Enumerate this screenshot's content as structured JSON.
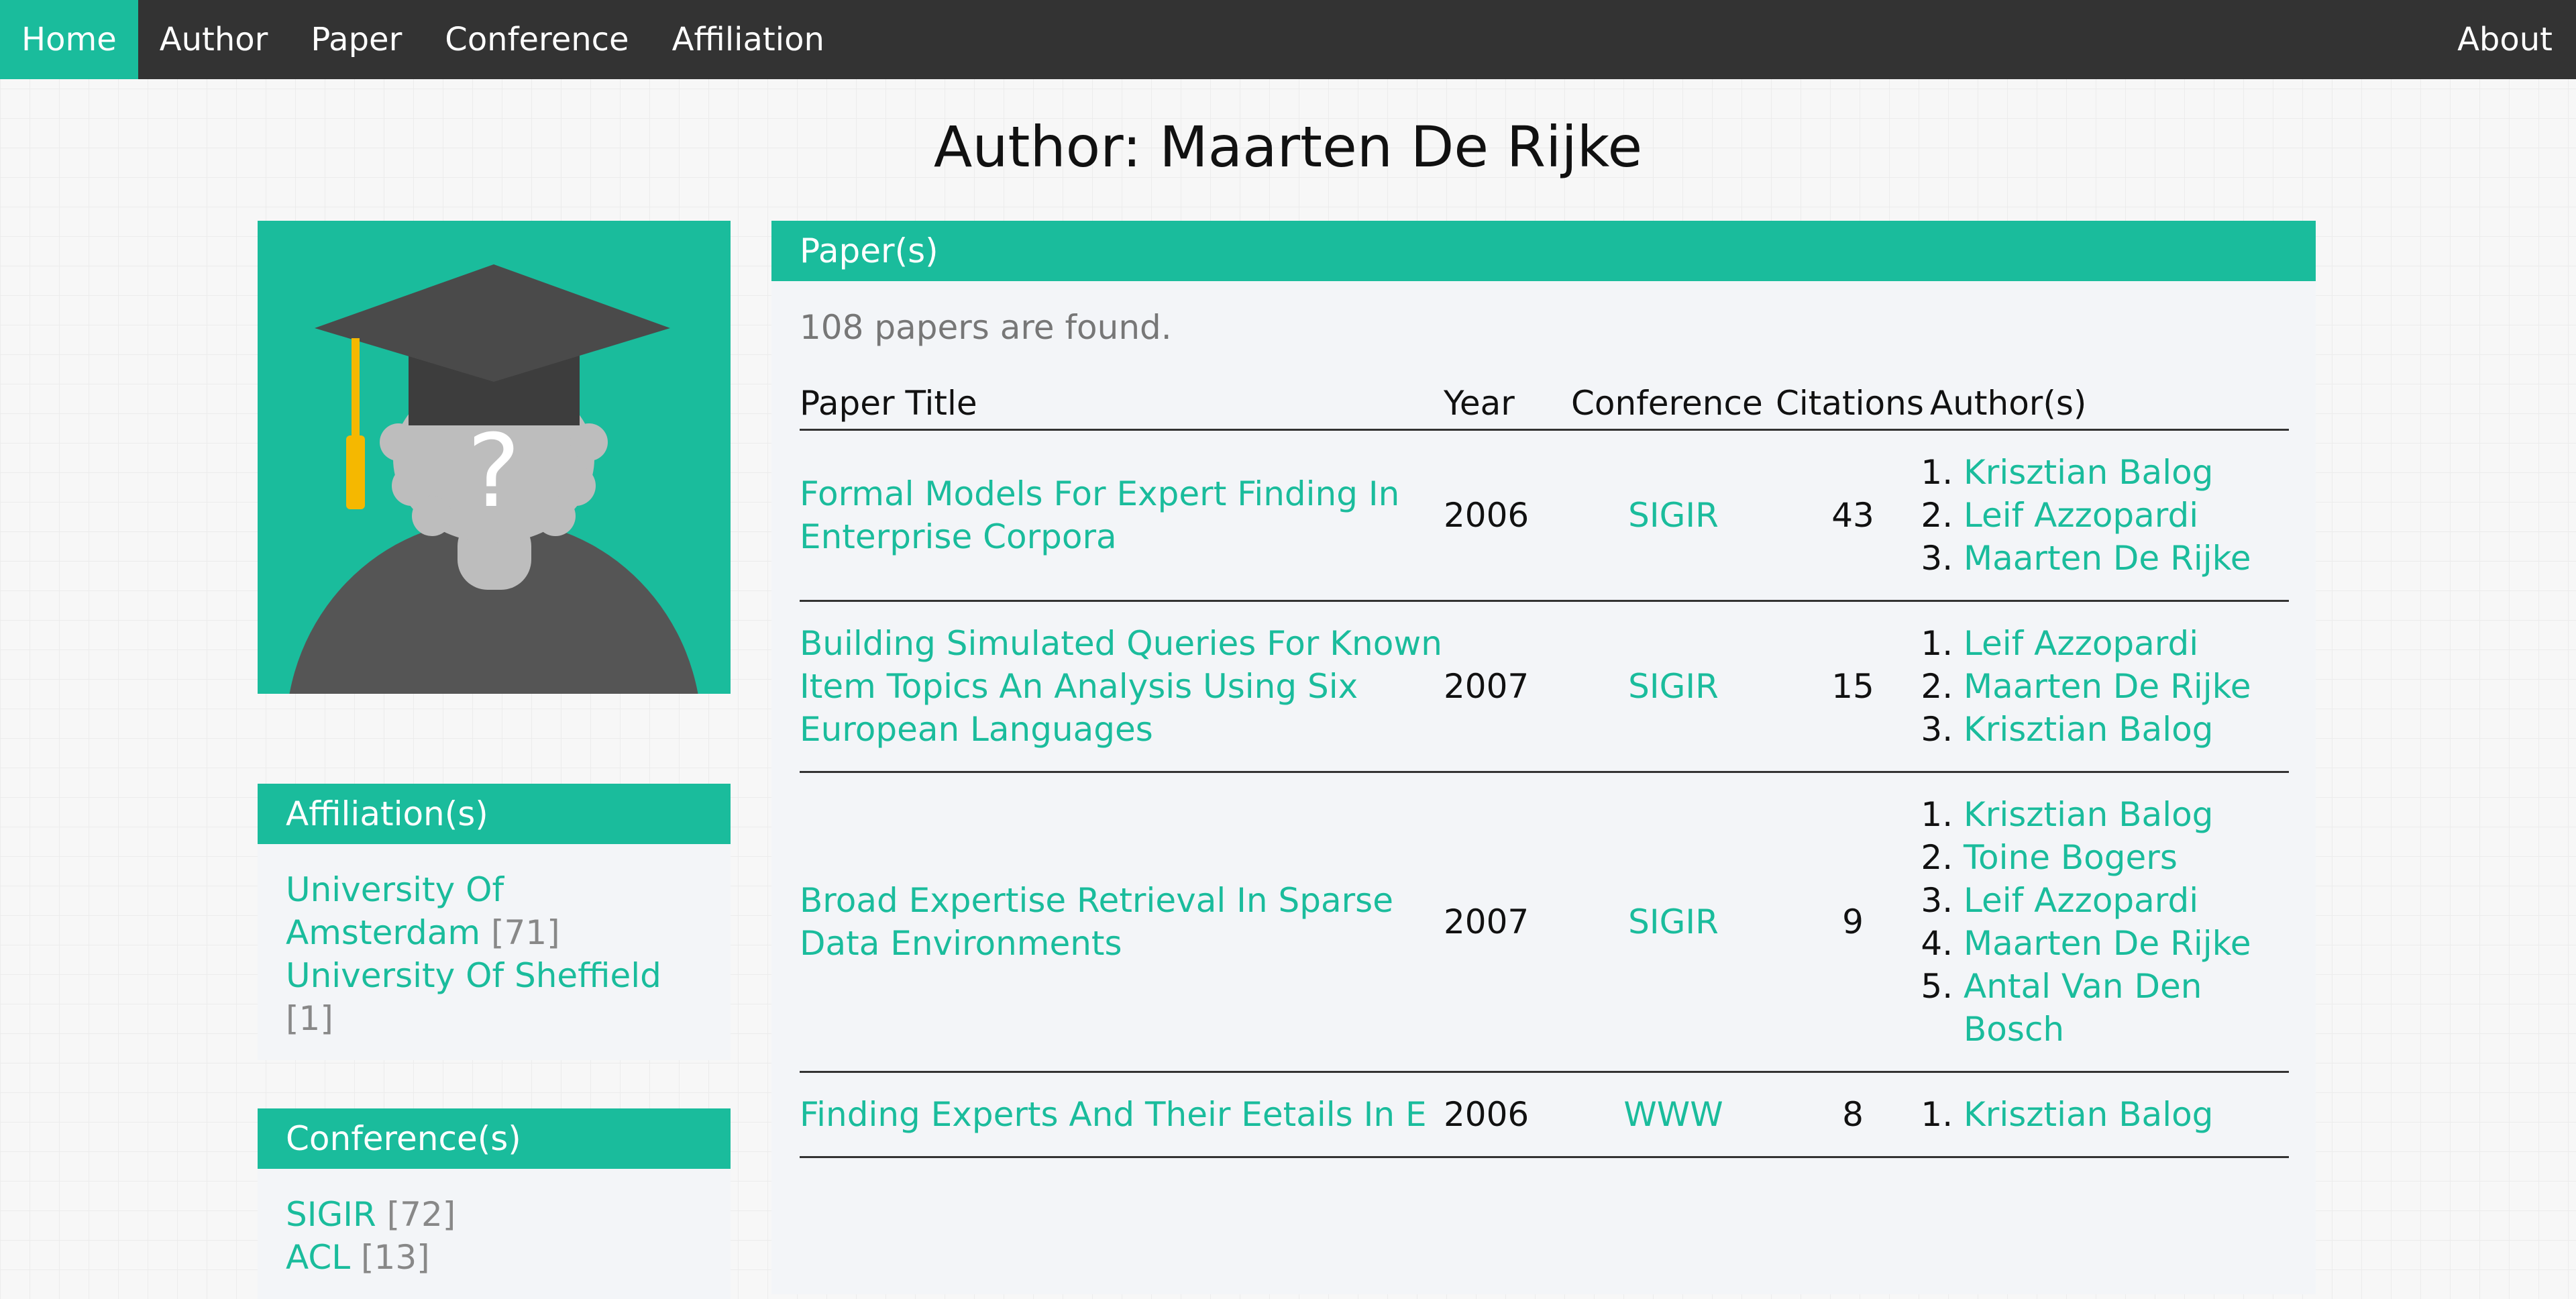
{
  "nav": {
    "items": [
      {
        "label": "Home",
        "active": true
      },
      {
        "label": "Author",
        "active": false
      },
      {
        "label": "Paper",
        "active": false
      },
      {
        "label": "Conference",
        "active": false
      },
      {
        "label": "Affiliation",
        "active": false
      }
    ],
    "about": "About"
  },
  "page_title": "Author: Maarten De Rijke",
  "avatar": {
    "icon": "graduate-avatar-icon",
    "question_mark": "?"
  },
  "affiliations": {
    "header": "Affiliation(s)",
    "items": [
      {
        "name": "University Of Amsterdam",
        "count": "[71]"
      },
      {
        "name": "University Of Sheffield",
        "count": "[1]"
      }
    ]
  },
  "conferences": {
    "header": "Conference(s)",
    "items": [
      {
        "name": "SIGIR",
        "count": "[72]"
      },
      {
        "name": "ACL",
        "count": "[13]"
      }
    ]
  },
  "papers": {
    "header": "Paper(s)",
    "found_text": "108 papers are found.",
    "columns": [
      "Paper Title",
      "Year",
      "Conference",
      "Citations",
      "Author(s)"
    ],
    "rows": [
      {
        "title": "Formal Models For Expert Finding In Enterprise Corpora",
        "year": "2006",
        "conference": "SIGIR",
        "citations": "43",
        "authors": [
          "Krisztian Balog",
          "Leif Azzopardi",
          "Maarten De Rijke"
        ]
      },
      {
        "title": "Building Simulated Queries For Known Item Topics An Analysis Using Six European Languages",
        "year": "2007",
        "conference": "SIGIR",
        "citations": "15",
        "authors": [
          "Leif Azzopardi",
          "Maarten De Rijke",
          "Krisztian Balog"
        ]
      },
      {
        "title": "Broad Expertise Retrieval In Sparse Data Environments",
        "year": "2007",
        "conference": "SIGIR",
        "citations": "9",
        "authors": [
          "Krisztian Balog",
          "Toine Bogers",
          "Leif Azzopardi",
          "Maarten De Rijke",
          "Antal Van Den Bosch"
        ]
      },
      {
        "title": "Finding Experts And Their Eetails In E",
        "year": "2006",
        "conference": "WWW",
        "citations": "8",
        "authors": [
          "Krisztian Balog"
        ]
      }
    ]
  },
  "colors": {
    "accent": "#1abc9c",
    "navbar": "#333333",
    "panel_bg": "#f3f5f8"
  }
}
